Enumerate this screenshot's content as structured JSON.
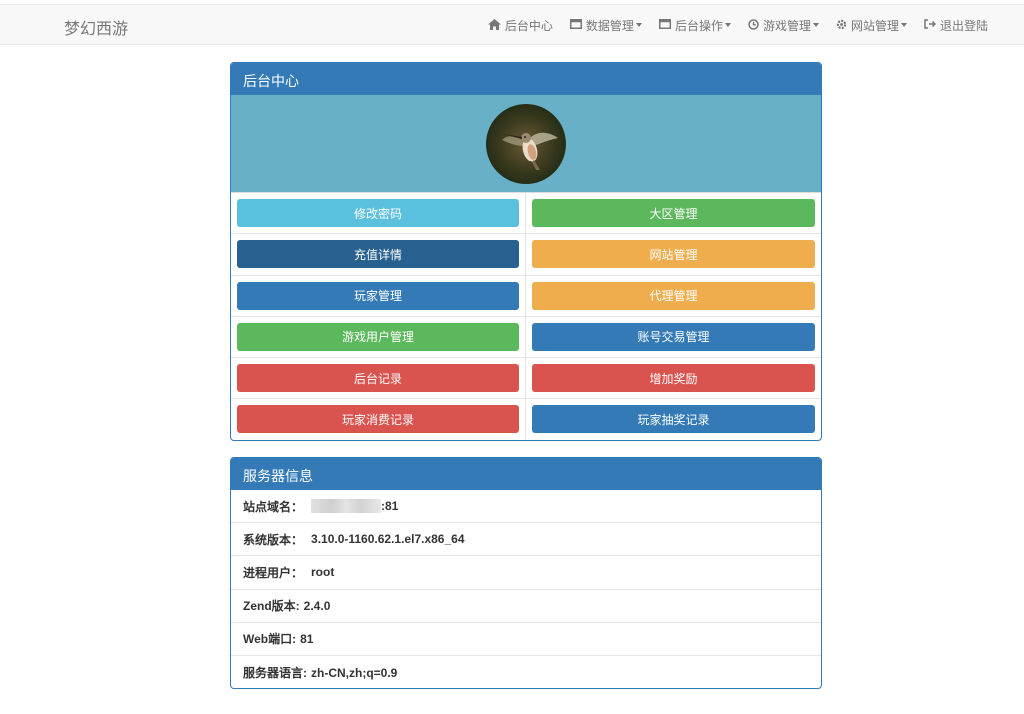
{
  "brand": "梦幻西游",
  "nav": [
    {
      "label": "后台中心",
      "icon": "home-icon",
      "dropdown": false
    },
    {
      "label": "数据管理",
      "icon": "window-icon",
      "dropdown": true
    },
    {
      "label": "后台操作",
      "icon": "window-icon",
      "dropdown": true
    },
    {
      "label": "游戏管理",
      "icon": "clock-icon",
      "dropdown": true
    },
    {
      "label": "网站管理",
      "icon": "gear-icon",
      "dropdown": true
    },
    {
      "label": "退出登陆",
      "icon": "logout-icon",
      "dropdown": false
    }
  ],
  "center_panel": {
    "title": "后台中心",
    "buttons": [
      {
        "label": "修改密码",
        "color": "#5bc0de"
      },
      {
        "label": "大区管理",
        "color": "#5cb85c"
      },
      {
        "label": "充值详情",
        "color": "#286090"
      },
      {
        "label": "网站管理",
        "color": "#f0ad4e"
      },
      {
        "label": "玩家管理",
        "color": "#337ab7"
      },
      {
        "label": "代理管理",
        "color": "#f0ad4e"
      },
      {
        "label": "游戏用户管理",
        "color": "#5cb85c"
      },
      {
        "label": "账号交易管理",
        "color": "#337ab7"
      },
      {
        "label": "后台记录",
        "color": "#d9534f"
      },
      {
        "label": "增加奖励",
        "color": "#d9534f"
      },
      {
        "label": "玩家消费记录",
        "color": "#d9534f"
      },
      {
        "label": "玩家抽奖记录",
        "color": "#337ab7"
      }
    ]
  },
  "server_panel": {
    "title": "服务器信息",
    "rows": [
      {
        "label": "站点域名：",
        "value": ":81"
      },
      {
        "label": "系统版本：",
        "value": "3.10.0-1160.62.1.el7.x86_64"
      },
      {
        "label": "进程用户：",
        "value": "root"
      },
      {
        "label": "Zend版本:",
        "value": "2.4.0"
      },
      {
        "label": "Web端口:",
        "value": "81"
      },
      {
        "label": "服务器语言:",
        "value": "zh-CN,zh;q=0.9"
      }
    ]
  }
}
